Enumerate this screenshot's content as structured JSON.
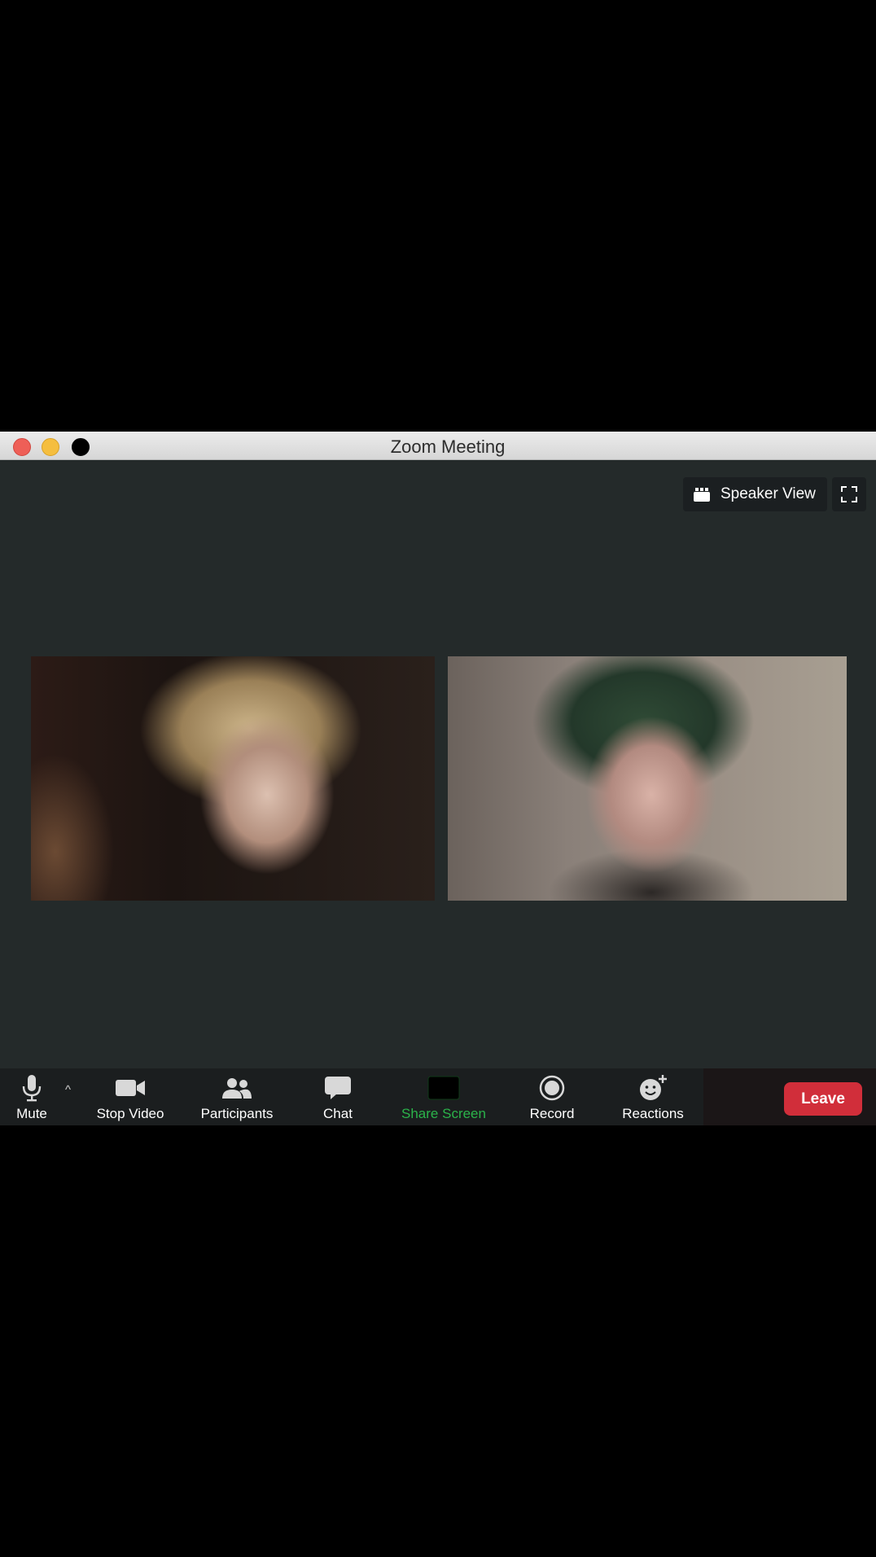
{
  "window": {
    "title": "Zoom Meeting"
  },
  "view_controls": {
    "speaker_view_label": "Speaker View",
    "speaker_view_icon": "grid-icon",
    "fullscreen_icon": "fullscreen-icon"
  },
  "video_tiles": [
    {
      "id": "left"
    },
    {
      "id": "right"
    }
  ],
  "toolbar": {
    "mute_label": "Mute",
    "stop_video_label": "Stop Video",
    "participants_label": "Participants",
    "chat_label": "Chat",
    "share_screen_label": "Share Screen",
    "record_label": "Record",
    "reactions_label": "Reactions",
    "leave_label": "Leave",
    "caret": "^"
  },
  "colors": {
    "background": "#000000",
    "meeting_bg": "#242a2a",
    "toolbar_bg": "#1b1e1f",
    "share_accent": "#2bb34a",
    "leave_red": "#d12e3a"
  }
}
